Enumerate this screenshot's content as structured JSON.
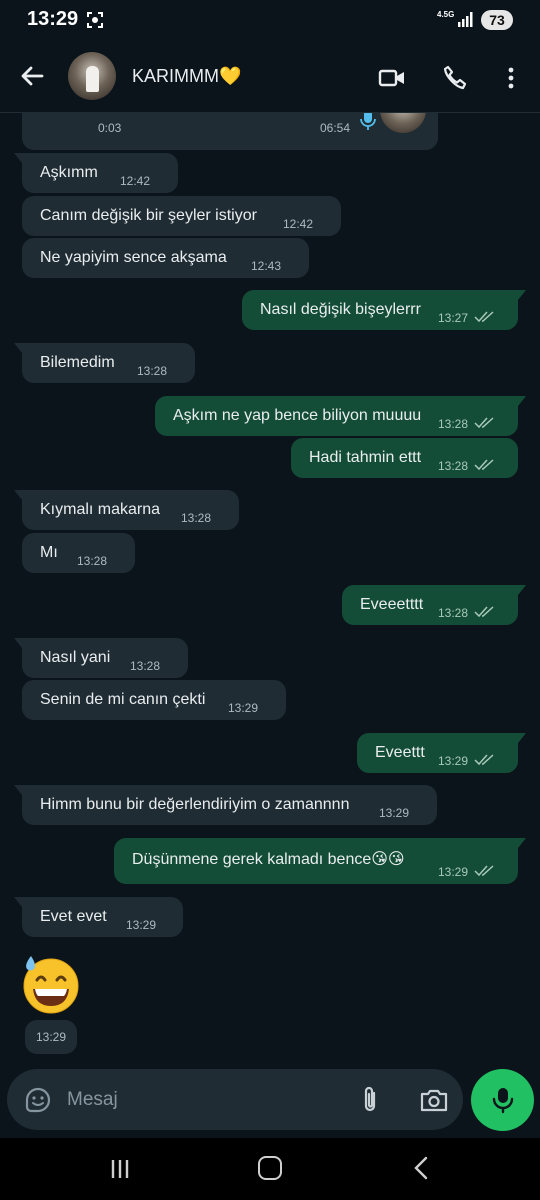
{
  "status_bar": {
    "time": "13:29",
    "network": "4.5G",
    "battery": "73"
  },
  "header": {
    "contact_name": "KARIMMM💛"
  },
  "voice_message": {
    "position": "0:03",
    "time": "06:54"
  },
  "messages": [
    {
      "dir": "in",
      "text": "Aşkımm",
      "time": "12:42"
    },
    {
      "dir": "in",
      "text": "Canım değişik bir şeyler istiyor",
      "time": "12:42"
    },
    {
      "dir": "in",
      "text": "Ne yapiyim sence akşama",
      "time": "12:43"
    },
    {
      "dir": "out",
      "text": "Nasıl değişik bişeylerrr",
      "time": "13:27"
    },
    {
      "dir": "in",
      "text": "Bilemedim",
      "time": "13:28"
    },
    {
      "dir": "out",
      "text": "Aşkım ne yap bence biliyon muuuu",
      "time": "13:28"
    },
    {
      "dir": "out",
      "text": "Hadi tahmin ettt",
      "time": "13:28"
    },
    {
      "dir": "in",
      "text": "Kıymalı makarna",
      "time": "13:28"
    },
    {
      "dir": "in",
      "text": "Mı",
      "time": "13:28"
    },
    {
      "dir": "out",
      "text": "Eveeetttt",
      "time": "13:28"
    },
    {
      "dir": "in",
      "text": "Nasıl yani",
      "time": "13:28"
    },
    {
      "dir": "in",
      "text": "Senin de mi canın çekti",
      "time": "13:29"
    },
    {
      "dir": "out",
      "text": "Eveettt",
      "time": "13:29"
    },
    {
      "dir": "in",
      "text": "Himm bunu bir değerlendiriyim o zamannnn",
      "time": "13:29"
    },
    {
      "dir": "out",
      "text": "Düşünmene gerek kalmadı bence😘😘",
      "time": "13:29"
    },
    {
      "dir": "in",
      "text": "Evet evet",
      "time": "13:29"
    }
  ],
  "emoji_message": {
    "time": "13:29",
    "icon": "grinning-sweat-emoji"
  },
  "composer": {
    "placeholder": "Mesaj"
  },
  "colors": {
    "background": "#0b141a",
    "incoming": "#1f2c33",
    "outgoing": "#144d37",
    "accent": "#21c063",
    "read_ticks": "#a8c9b9"
  }
}
